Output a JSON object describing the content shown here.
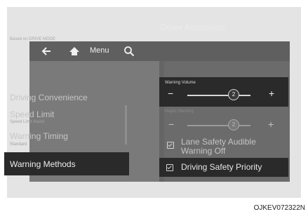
{
  "topbar": {
    "menu_label": "Menu"
  },
  "header": {
    "title": "Driver Assistance"
  },
  "sidebar": {
    "group_label": "Based on DRIVE MODE",
    "items": [
      {
        "label": "Driving Convenience",
        "sub": ""
      },
      {
        "label": "Speed Limit",
        "sub": "Speed Limit Assist"
      },
      {
        "label": "Warning Timing",
        "sub": "Standard"
      },
      {
        "label": "Warning Methods",
        "sub": ""
      }
    ]
  },
  "settings": {
    "warning_volume": {
      "label": "Warning Volume",
      "value": "2",
      "minus": "−",
      "plus": "+"
    },
    "haptic_warning": {
      "label": "Haptic Warning",
      "value": "2",
      "minus": "−",
      "plus": "+"
    },
    "options": [
      {
        "label_line1": "Lane Safety Audible",
        "label_line2": "Warning Off",
        "checked": true
      },
      {
        "label_line1": "Driving Safety Priority",
        "label_line2": "",
        "checked": true
      }
    ]
  },
  "caption": "OJKEV072322N"
}
